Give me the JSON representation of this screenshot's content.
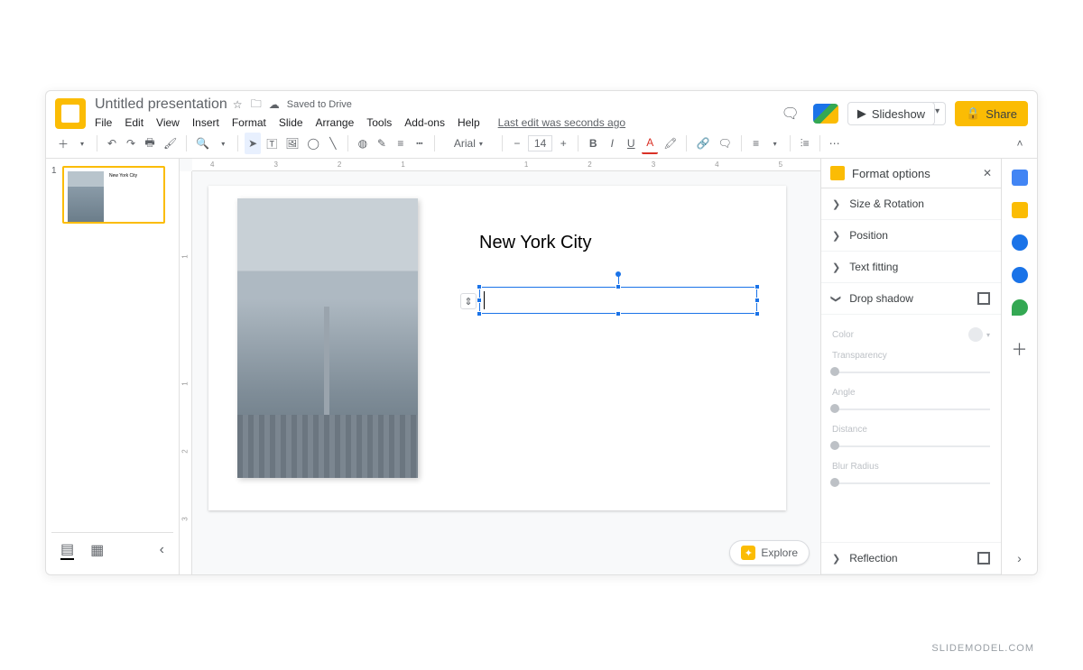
{
  "header": {
    "title": "Untitled presentation",
    "drive_status": "Saved to Drive",
    "menu": [
      "File",
      "Edit",
      "View",
      "Insert",
      "Format",
      "Slide",
      "Arrange",
      "Tools",
      "Add-ons",
      "Help"
    ],
    "last_edit": "Last edit was seconds ago",
    "slideshow_label": "Slideshow",
    "share_label": "Share"
  },
  "toolbar": {
    "font_name": "Arial",
    "font_size": "14"
  },
  "ruler": {
    "h": [
      "4",
      "3",
      "2",
      "1",
      "",
      "1",
      "2",
      "3",
      "4",
      "5"
    ],
    "v": [
      "1",
      "",
      "1",
      "2",
      "3"
    ]
  },
  "thumb": {
    "num": "1",
    "caption": "New York City"
  },
  "slide": {
    "title": "New York City"
  },
  "explore": "Explore",
  "panel": {
    "title": "Format options",
    "sections": {
      "size_rotation": "Size & Rotation",
      "position": "Position",
      "text_fitting": "Text fitting",
      "drop_shadow": "Drop shadow",
      "reflection": "Reflection"
    },
    "ds": {
      "color": "Color",
      "transparency": "Transparency",
      "angle": "Angle",
      "distance": "Distance",
      "blur": "Blur Radius"
    }
  },
  "watermark": "SLIDEMODEL.COM"
}
